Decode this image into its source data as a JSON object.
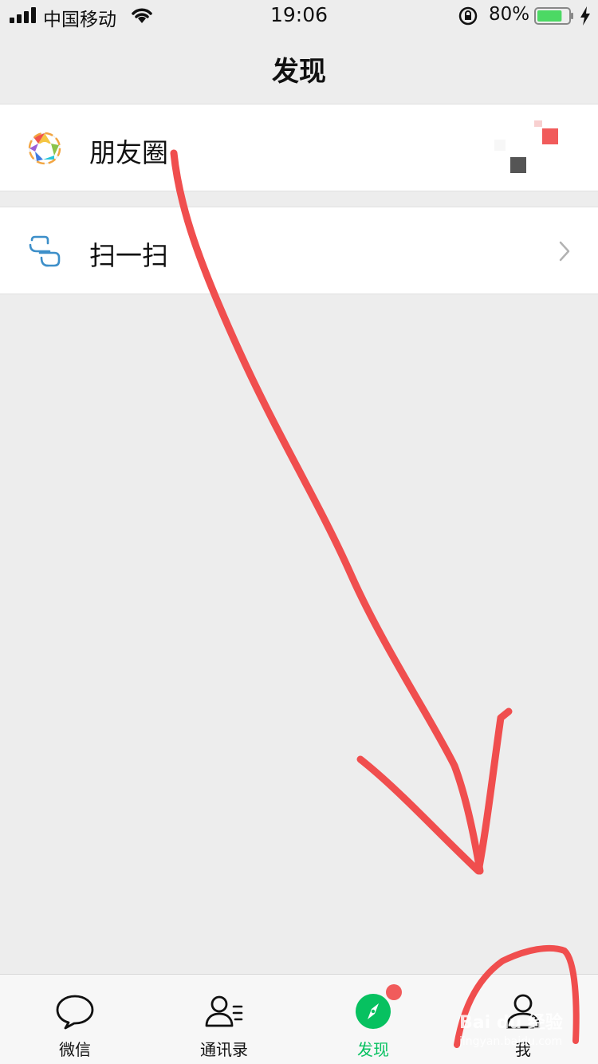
{
  "status_bar": {
    "carrier": "中国移动",
    "time": "19:06",
    "battery_percent": "80%",
    "battery_level": 0.8,
    "signal_icon": "signal-bars-icon",
    "wifi_icon": "wifi-icon",
    "lock_icon": "rotation-lock-icon",
    "charging_icon": "bolt-icon"
  },
  "nav": {
    "title": "发现"
  },
  "cells": {
    "moments": {
      "label": "朋友圈",
      "icon": "moments-aperture-icon"
    },
    "scan": {
      "label": "扫一扫",
      "icon": "scan-icon",
      "chevron": "chevron-right-icon"
    }
  },
  "tab_bar": {
    "tabs": [
      {
        "label": "微信",
        "icon": "chat-bubble-icon",
        "active": false
      },
      {
        "label": "通讯录",
        "icon": "contacts-icon",
        "active": false
      },
      {
        "label": "发现",
        "icon": "compass-icon",
        "active": true,
        "badge": true
      },
      {
        "label": "我",
        "icon": "person-icon",
        "active": false
      }
    ]
  },
  "colors": {
    "accent_green": "#07c160",
    "badge_red": "#f15b5b",
    "annotation_red": "#f04e4e",
    "background": "#ededed",
    "cell_bg": "#ffffff",
    "chevron_gray": "#b2b2b2"
  },
  "watermark": {
    "brand": "Bai du 经验",
    "url": "jingyan.baidu.com"
  }
}
